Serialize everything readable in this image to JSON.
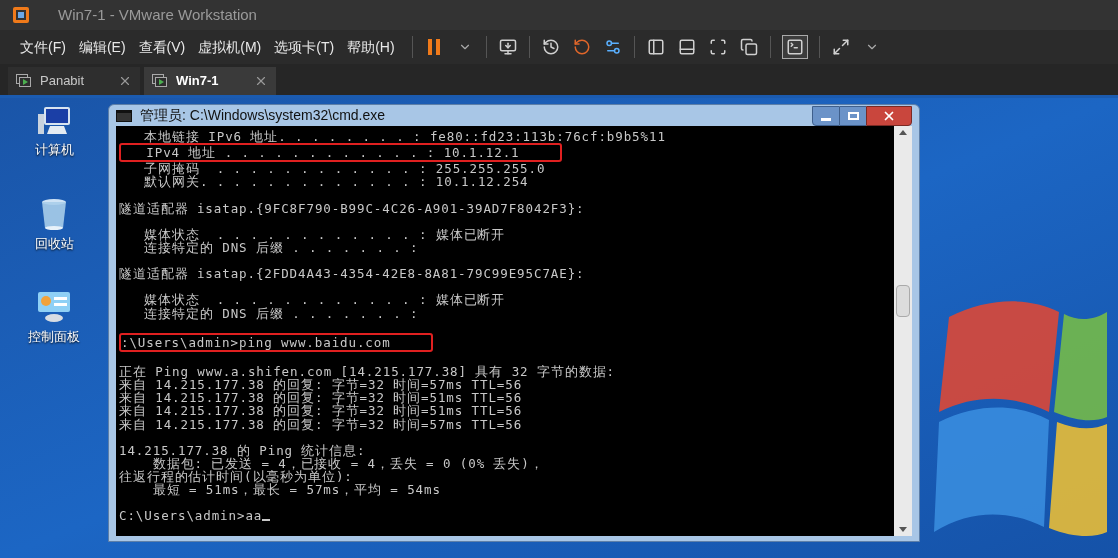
{
  "window": {
    "title": "Win7-1 - VMware Workstation"
  },
  "menu": [
    "文件(F)",
    "编辑(E)",
    "查看(V)",
    "虚拟机(M)",
    "选项卡(T)",
    "帮助(H)"
  ],
  "toolbar_groups": [
    [
      {
        "kind": "pause",
        "selected": false
      },
      {
        "kind": "caret",
        "selected": false
      }
    ],
    [
      {
        "kind": "send_keys",
        "selected": false
      }
    ],
    [
      {
        "kind": "snapshot_take",
        "selected": false
      },
      {
        "kind": "snapshot_revert",
        "selected": false
      },
      {
        "kind": "snapshot_manager",
        "selected": false
      }
    ],
    [
      {
        "kind": "view_sidebar",
        "selected": false
      },
      {
        "kind": "view_thumbnail",
        "selected": false
      },
      {
        "kind": "view_fullscreen",
        "selected": false
      },
      {
        "kind": "view_unity",
        "selected": false
      }
    ],
    [
      {
        "kind": "console",
        "selected": true
      }
    ],
    [
      {
        "kind": "stretch",
        "selected": false
      },
      {
        "kind": "caret",
        "selected": false
      }
    ]
  ],
  "tabs": [
    {
      "label": "Panabit",
      "selected": false
    },
    {
      "label": "Win7-1",
      "selected": true
    }
  ],
  "desktop_icons": [
    {
      "kind": "computer",
      "label": "计算机"
    },
    {
      "kind": "recycle_bin",
      "label": "回收站"
    },
    {
      "kind": "control_panel",
      "label": "控制面板"
    }
  ],
  "cmd_window": {
    "title": "管理员: C:\\Windows\\system32\\cmd.exe",
    "blocks": [
      {
        "lines": [
          {
            "text": "   本地链接 IPv6 地址. . . . . . . . : fe80::fd23:113b:76cf:b9b5%11",
            "highlighted": false
          },
          {
            "text": "   IPv4 地址 . . . . . . . . . . . . : 10.1.12.1",
            "highlighted": true
          },
          {
            "text": "   子网掩码  . . . . . . . . . . . . : 255.255.255.0",
            "highlighted": false
          },
          {
            "text": "   默认网关. . . . . . . . . . . . . : 10.1.12.254",
            "highlighted": false
          }
        ]
      },
      {
        "lines": [
          {
            "text": "隧道适配器 isatap.{9FC8F790-B99C-4C26-A901-39AD7F8042F3}:",
            "highlighted": false
          }
        ]
      },
      {
        "lines": [
          {
            "text": "   媒体状态  . . . . . . . . . . . . : 媒体已断开",
            "highlighted": false
          },
          {
            "text": "   连接特定的 DNS 后缀 . . . . . . . :",
            "highlighted": false
          }
        ]
      },
      {
        "lines": [
          {
            "text": "隧道适配器 isatap.{2FDD4A43-4354-42E8-8A81-79C99E95C7AE}:",
            "highlighted": false
          }
        ]
      },
      {
        "lines": [
          {
            "text": "   媒体状态  . . . . . . . . . . . . : 媒体已断开",
            "highlighted": false
          },
          {
            "text": "   连接特定的 DNS 后缀 . . . . . . . :",
            "highlighted": false
          }
        ]
      },
      {
        "lines": [
          {
            "text": ":\\Users\\admin>ping www.baidu.com",
            "highlighted": true
          }
        ]
      },
      {
        "lines": [
          {
            "text": "正在 Ping www.a.shifen.com [14.215.177.38] 具有 32 字节的数据:",
            "highlighted": false
          },
          {
            "text": "来自 14.215.177.38 的回复: 字节=32 时间=57ms TTL=56",
            "highlighted": false
          },
          {
            "text": "来自 14.215.177.38 的回复: 字节=32 时间=51ms TTL=56",
            "highlighted": false
          },
          {
            "text": "来自 14.215.177.38 的回复: 字节=32 时间=51ms TTL=56",
            "highlighted": false
          },
          {
            "text": "来自 14.215.177.38 的回复: 字节=32 时间=57ms TTL=56",
            "highlighted": false
          }
        ]
      },
      {
        "lines": [
          {
            "text": "14.215.177.38 的 Ping 统计信息:",
            "highlighted": false
          },
          {
            "text": "    数据包: 已发送 = 4，已接收 = 4，丢失 = 0 (0% 丢失)，",
            "highlighted": false
          },
          {
            "text": "往返行程的估计时间(以毫秒为单位):",
            "highlighted": false
          },
          {
            "text": "    最短 = 51ms，最长 = 57ms，平均 = 54ms",
            "highlighted": false
          }
        ]
      },
      {
        "lines": [
          {
            "text": "C:\\Users\\admin>aa",
            "highlighted": false
          }
        ]
      }
    ]
  }
}
